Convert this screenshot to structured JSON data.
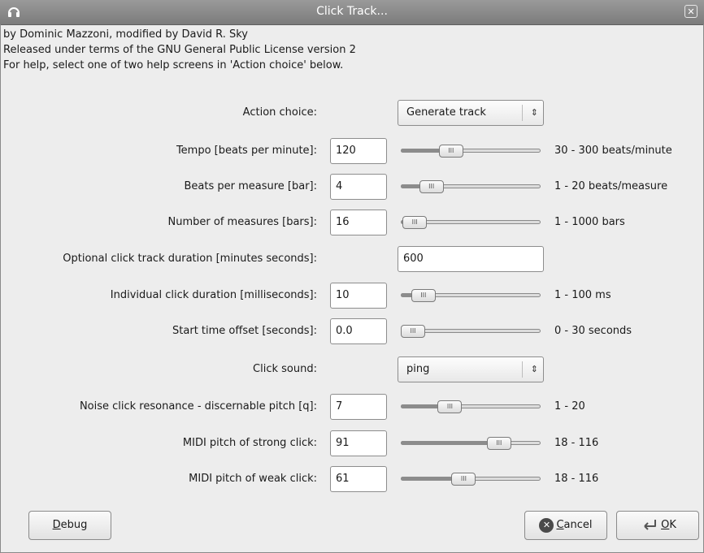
{
  "window": {
    "title": "Click Track..."
  },
  "header": {
    "line1": "by Dominic Mazzoni, modified by David R. Sky",
    "line2": "Released under terms of the GNU General Public License version 2",
    "line3": "For help, select one of two help screens in 'Action choice' below."
  },
  "action_choice": {
    "label": "Action choice:",
    "value": "Generate track"
  },
  "tempo": {
    "label": "Tempo [beats per minute]:",
    "value": "120",
    "range": "30 - 300 beats/minute",
    "slider_fraction": 0.33
  },
  "beats": {
    "label": "Beats per measure [bar]:",
    "value": "4",
    "range": "1 - 20 beats/measure",
    "slider_fraction": 0.16
  },
  "measures": {
    "label": "Number of measures [bars]:",
    "value": "16",
    "range": "1 - 1000 bars",
    "slider_fraction": 0.015
  },
  "duration": {
    "label": "Optional click track duration [minutes seconds]:",
    "value": "600"
  },
  "click_duration": {
    "label": "Individual click duration [milliseconds]:",
    "value": "10",
    "range": "1 - 100 ms",
    "slider_fraction": 0.09
  },
  "offset": {
    "label": "Start time offset [seconds]:",
    "value": "0.0",
    "range": "0 - 30 seconds",
    "slider_fraction": 0.0
  },
  "click_sound": {
    "label": "Click sound:",
    "value": "ping"
  },
  "resonance": {
    "label": "Noise click resonance - discernable pitch [q]:",
    "value": "7",
    "range": "1 - 20",
    "slider_fraction": 0.32
  },
  "strong_pitch": {
    "label": "MIDI pitch of strong click:",
    "value": "91",
    "range": "18 - 116",
    "slider_fraction": 0.745
  },
  "weak_pitch": {
    "label": "MIDI pitch of weak click:",
    "value": "61",
    "range": "18 - 116",
    "slider_fraction": 0.44
  },
  "buttons": {
    "debug_mnemonic": "D",
    "debug_rest": "ebug",
    "cancel_mnemonic": "C",
    "cancel_rest": "ancel",
    "ok_mnemonic": "O",
    "ok_rest": "K"
  },
  "icons": {
    "app": "headphones-icon",
    "close": "close-icon",
    "cancel": "cancel-icon",
    "ok": "ok-arrow-icon"
  },
  "thumb_grip": "III"
}
